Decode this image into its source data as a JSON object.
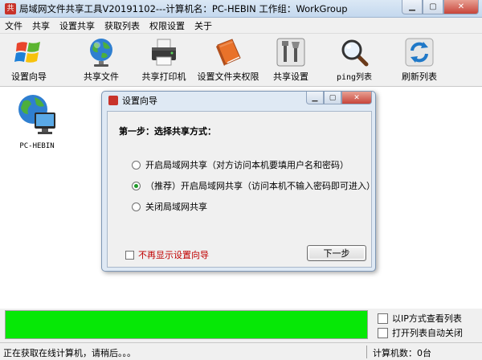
{
  "window": {
    "title": "局域网文件共享工具V20191102---计算机名：PC-HEBIN  工作组：WorkGroup",
    "icon_glyph": "共"
  },
  "menu": [
    "文件",
    "共享",
    "设置共享",
    "获取列表",
    "权限设置",
    "关于"
  ],
  "toolbar": [
    {
      "label": "设置向导",
      "icon": "windows-logo-icon"
    },
    {
      "label": "共享文件",
      "icon": "globe-icon"
    },
    {
      "label": "共享打印机",
      "icon": "printer-icon"
    },
    {
      "label": "设置文件夹权限",
      "icon": "book-icon"
    },
    {
      "label": "共享设置",
      "icon": "tools-icon"
    },
    {
      "label": "ping列表",
      "icon": "magnifier-icon"
    },
    {
      "label": "刷新列表",
      "icon": "refresh-icon"
    }
  ],
  "computers": [
    {
      "name": "PC-HEBIN",
      "icon": "network-computer-icon"
    }
  ],
  "dialog": {
    "title": "设置向导",
    "step_title": "第一步：选择共享方式：",
    "options": [
      {
        "label": "开启局域网共享（对方访问本机要填用户名和密码）",
        "selected": false
      },
      {
        "label": "（推荐）开启局域网共享（访问本机不输入密码即可进入）",
        "selected": true
      },
      {
        "label": "关闭局域网共享",
        "selected": false
      }
    ],
    "dont_show_label": "不再显示设置向导",
    "next_label": "下一步"
  },
  "bottom": {
    "progress_fraction": 1.0,
    "progress_color": "#06e806",
    "checkbox_ip_label": "以IP方式查看列表",
    "checkbox_auto_close_label": "打开列表自动关闭"
  },
  "status": {
    "left": "正在获取在线计算机，请稍后。。。",
    "right": "计算机数：0台"
  }
}
